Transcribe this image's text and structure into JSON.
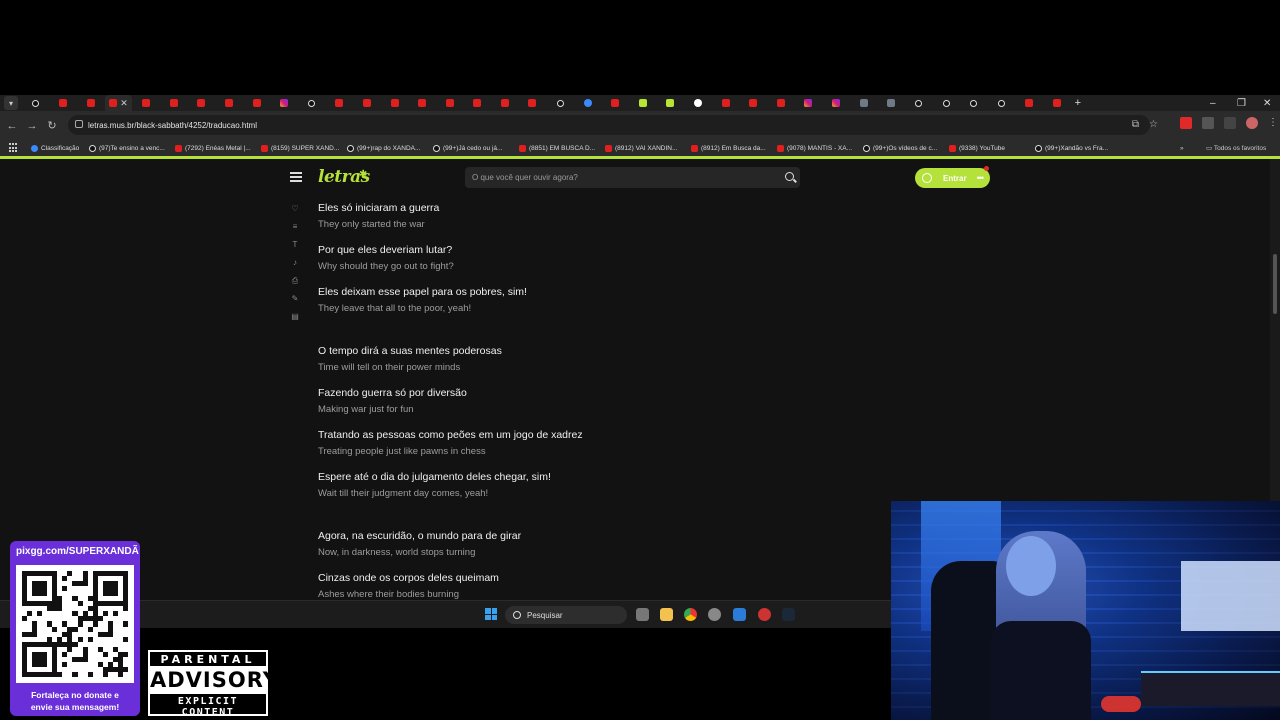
{
  "browser": {
    "url": "letras.mus.br/black-sabbath/4252/traducao.html",
    "tabs": [
      "tk",
      "yt",
      "yt",
      "yt",
      "yt",
      "yt",
      "yt",
      "yt",
      "yt",
      "ig",
      "tk",
      "yt",
      "yt",
      "yt",
      "yt",
      "yt",
      "yt",
      "yt",
      "yt",
      "tk",
      "g",
      "yt",
      "lt",
      "lt",
      "wh",
      "yt",
      "yt",
      "yt",
      "ig",
      "ig",
      "gy",
      "gy",
      "tk",
      "tk",
      "tk",
      "tk",
      "yt",
      "yt"
    ],
    "bookmarks_all_label": "Todos os favoritos",
    "bookmarks": [
      {
        "label": "Classificação",
        "icon": "g"
      },
      {
        "label": "(97)Te ensino a venc...",
        "icon": "tk"
      },
      {
        "label": "(7292) Enéas Metal |...",
        "icon": "yt"
      },
      {
        "label": "(8159) SUPER XAND...",
        "icon": "yt"
      },
      {
        "label": "(99+)rap do XANDÃ...",
        "icon": "tk"
      },
      {
        "label": "(99+)Já cedo ou já...",
        "icon": "tk"
      },
      {
        "label": "(8851) EM BUSCA D...",
        "icon": "yt"
      },
      {
        "label": "(8912) VAI XANDIN...",
        "icon": "yt"
      },
      {
        "label": "(8912) Em Busca da...",
        "icon": "yt"
      },
      {
        "label": "(9078) MANTIS - XA...",
        "icon": "yt"
      },
      {
        "label": "(99+)Os vídeos de c...",
        "icon": "tk"
      },
      {
        "label": "(9338) YouTube",
        "icon": "yt"
      },
      {
        "label": "(99+)Xandão vs Fra...",
        "icon": "tk"
      }
    ]
  },
  "site": {
    "logo": "letras",
    "search_placeholder": "O que você quer ouvir agora?",
    "login_label": "Entrar",
    "more_label": "•••"
  },
  "lyrics": [
    [
      {
        "orig": "Eles só iniciaram a guerra",
        "trans": "They only started the war"
      },
      {
        "orig": "Por que eles deveriam lutar?",
        "trans": "Why should they go out to fight?"
      },
      {
        "orig": "Eles deixam esse papel para os pobres, sim!",
        "trans": "They leave that all to the poor, yeah!"
      }
    ],
    [
      {
        "orig": "O tempo dirá a suas mentes poderosas",
        "trans": "Time will tell on their power minds"
      },
      {
        "orig": "Fazendo guerra só por diversão",
        "trans": "Making war just for fun"
      },
      {
        "orig": "Tratando as pessoas como peões em um jogo de xadrez",
        "trans": "Treating people just like pawns in chess"
      },
      {
        "orig": "Espere até o dia do julgamento deles chegar, sim!",
        "trans": "Wait till their judgment day comes, yeah!"
      }
    ],
    [
      {
        "orig": "Agora, na escuridão, o mundo para de girar",
        "trans": "Now, in darkness, world stops turning"
      },
      {
        "orig": "Cinzas onde os corpos deles queimam",
        "trans": "Ashes where their bodies burning"
      }
    ]
  ],
  "taskbar": {
    "search_label": "Pesquisar"
  },
  "overlay": {
    "qr_title": "pixgg.com/SUPERXANDÃ",
    "qr_footer_1": "Fortaleça no donate e",
    "qr_footer_2": "envie sua mensagem!",
    "advisory_top": "PARENTAL",
    "advisory_mid": "ADVISORY",
    "advisory_bot": "EXPLICIT CONTENT"
  },
  "colors": {
    "accent": "#b4e23a",
    "qr_card": "#6a2fd8"
  }
}
